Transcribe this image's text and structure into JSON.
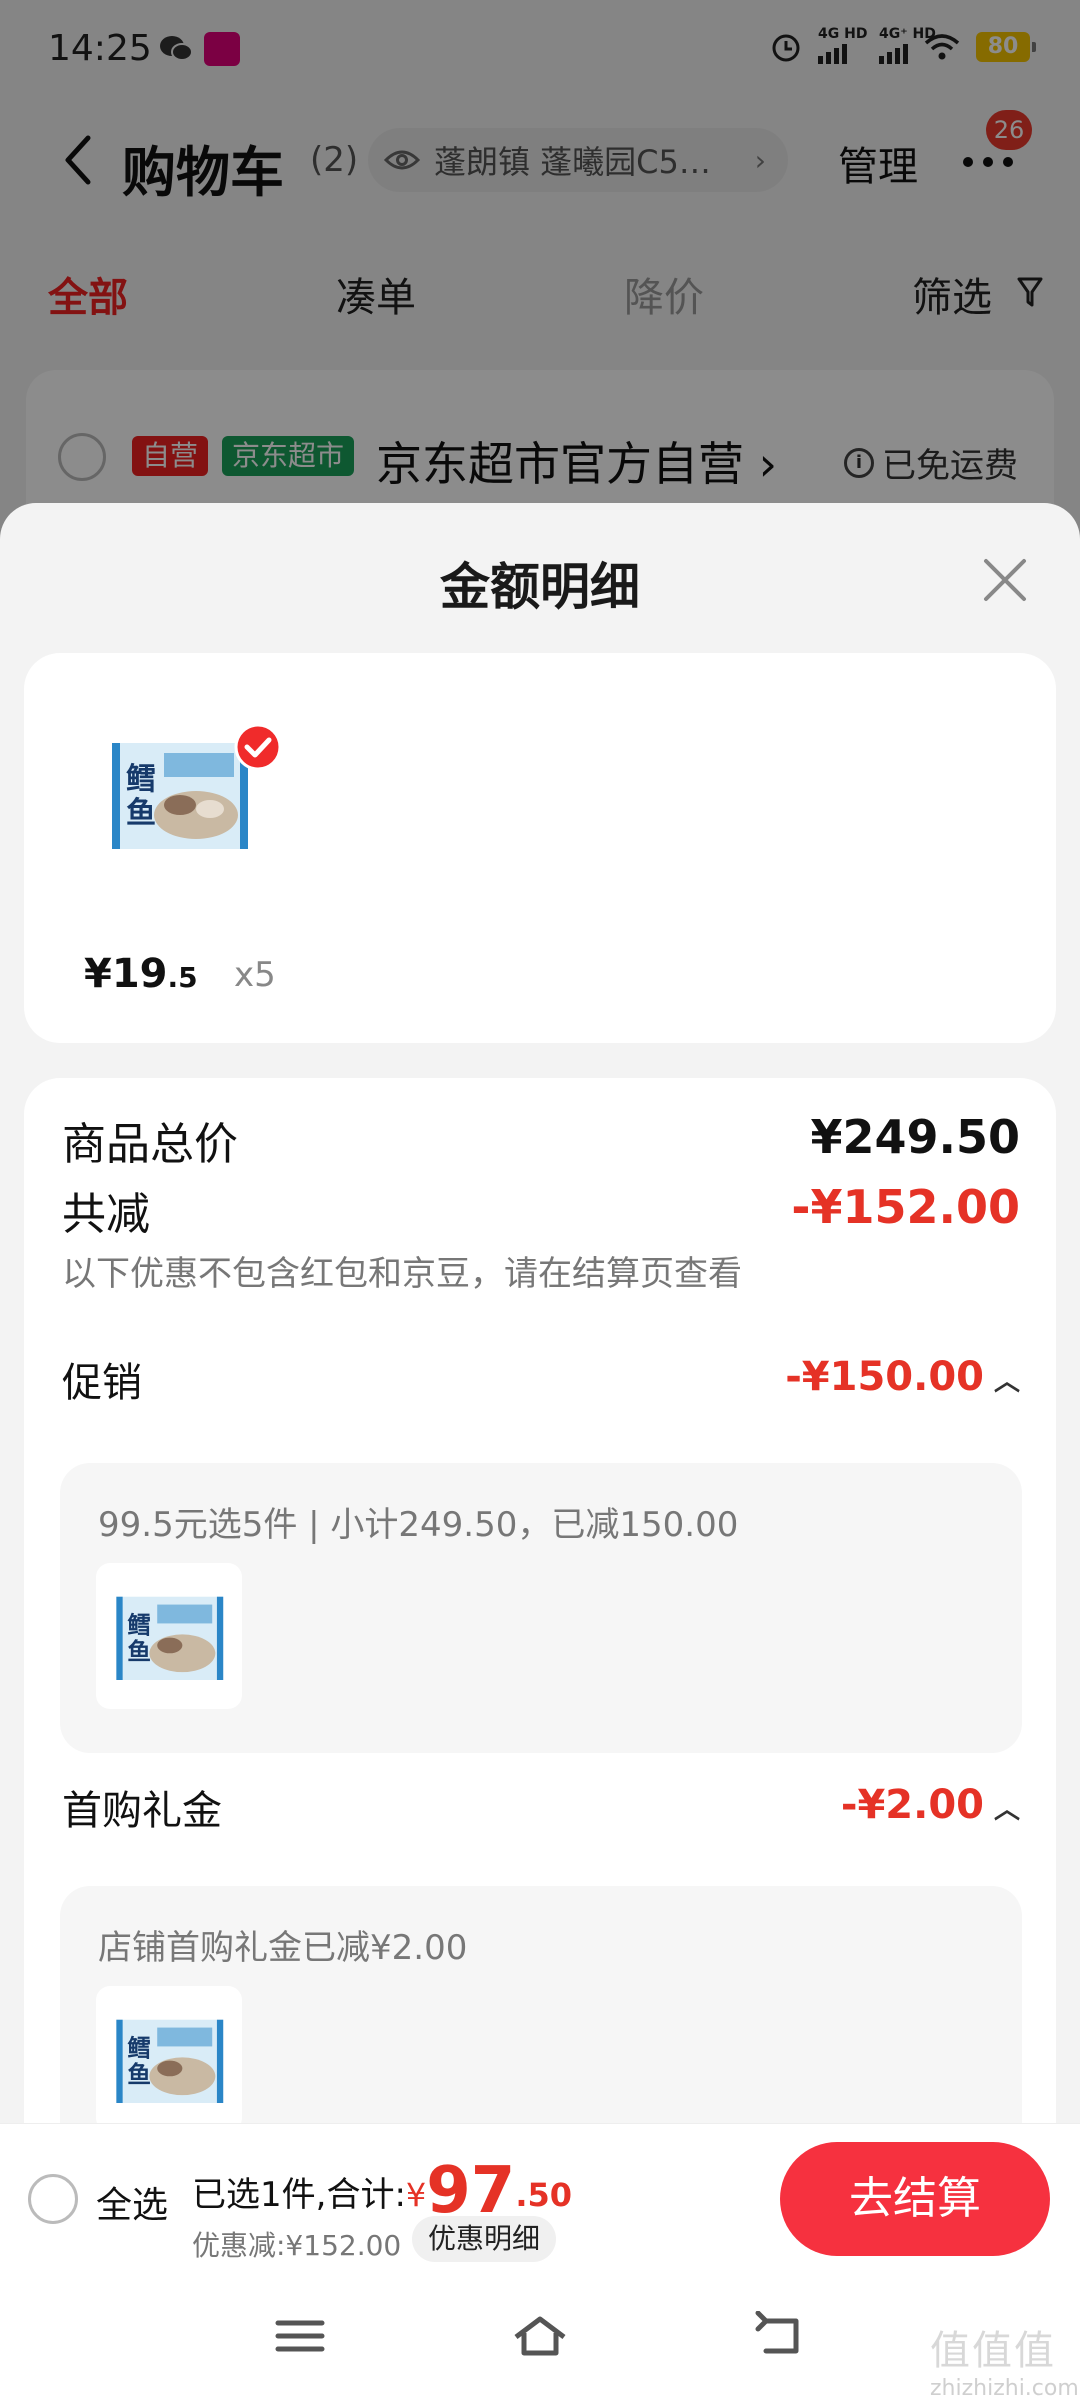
{
  "status_bar": {
    "time": "14:25",
    "signal1": "4G HD",
    "signal2": "4G⁺ HD",
    "battery": "80"
  },
  "header": {
    "title": "购物车",
    "count": "(2)",
    "address": "蓬朗镇 蓬曦园C5…",
    "manage_label": "管理",
    "more_badge": "26"
  },
  "filter_tabs": [
    {
      "label": "全部",
      "state": "active"
    },
    {
      "label": "凑单",
      "state": "normal"
    },
    {
      "label": "降价",
      "state": "dim"
    },
    {
      "label": "筛选",
      "state": "normal"
    }
  ],
  "shop": {
    "tag_self": "自营",
    "tag_market": "京东超市",
    "name": "京东超市官方自营 ›",
    "shipping": "已免运费"
  },
  "sheet": {
    "title": "金额明细",
    "product": {
      "price_int": "¥19",
      "price_dec": ".5",
      "qty": "x5",
      "thumb_text": "鳕鱼"
    },
    "total": {
      "label": "商品总价",
      "value": "¥249.50"
    },
    "reduction": {
      "label": "共减",
      "value": "-¥152.00",
      "note": "以下优惠不包含红包和京豆，请在结算页查看"
    },
    "promo": {
      "label": "促销",
      "value": "-¥150.00",
      "desc": "99.5元选5件 | 小计249.50，已减150.00"
    },
    "gift": {
      "label": "首购礼金",
      "value": "-¥2.00",
      "desc": "店铺首购礼金已减¥2.00"
    }
  },
  "checkout": {
    "select_all": "全选",
    "summary_prefix": "已选1件,合计:",
    "currency": "¥",
    "total_int": "97",
    "total_dec": ".50",
    "discount": "优惠减:¥152.00",
    "detail_label": "优惠明细",
    "checkout_label": "去结算"
  },
  "colors": {
    "accent_red": "#e53226",
    "button_red": "#f6313f",
    "tag_green": "#1ba05a"
  },
  "watermark": {
    "big": "值值值",
    "small": "zhizhizhi.com"
  }
}
